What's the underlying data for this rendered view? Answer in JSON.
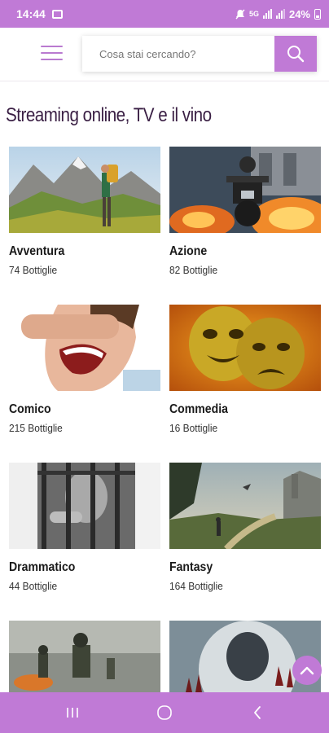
{
  "status_bar": {
    "time": "14:44",
    "network": "5G",
    "battery": "24%",
    "icons": [
      "gallery-icon",
      "mute-icon",
      "signal-icon",
      "battery-icon"
    ]
  },
  "header": {
    "menu_icon": "hamburger-icon",
    "search": {
      "placeholder": "Cosa stai cercando?",
      "value": "",
      "button_icon": "search-icon"
    }
  },
  "section": {
    "title": "Streaming online, TV e il vino",
    "categories": [
      {
        "name": "Avventura",
        "count": "74 Bottiglie",
        "image": "hiker-mountains"
      },
      {
        "name": "Azione",
        "count": "82 Bottiglie",
        "image": "motorcycle-explosion"
      },
      {
        "name": "Comico",
        "count": "215 Bottiglie",
        "image": "laughing-man"
      },
      {
        "name": "Commedia",
        "count": "16 Bottiglie",
        "image": "golden-masks"
      },
      {
        "name": "Drammatico",
        "count": "44 Bottiglie",
        "image": "man-behind-bars"
      },
      {
        "name": "Fantasy",
        "count": "164 Bottiglie",
        "image": "fantasy-landscape"
      },
      {
        "name": "",
        "count": "",
        "image": "war-soldiers"
      },
      {
        "name": "",
        "count": "",
        "image": "hooded-figure"
      }
    ]
  },
  "scroll_top_icon": "chevron-up-icon",
  "nav_bar": {
    "icons": [
      "recent-apps-icon",
      "home-icon",
      "back-icon"
    ]
  },
  "colors": {
    "accent": "#c07ad6",
    "title": "#3a1f44"
  }
}
